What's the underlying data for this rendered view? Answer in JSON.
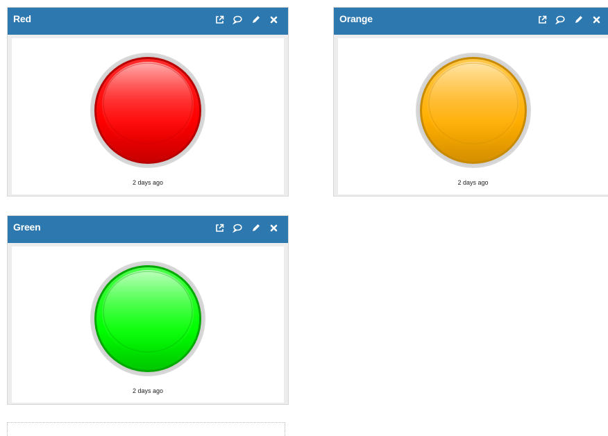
{
  "widgets": [
    {
      "id": "red",
      "title": "Red",
      "status": "red",
      "color": "#ff0000",
      "timestamp": "2 days ago",
      "tools": [
        "external-link-icon",
        "comment-icon",
        "pencil-icon",
        "close-icon"
      ]
    },
    {
      "id": "orange",
      "title": "Orange",
      "status": "orange",
      "color": "#ffae00",
      "timestamp": "2 days ago",
      "tools": [
        "external-link-icon",
        "comment-icon",
        "pencil-icon",
        "close-icon"
      ]
    },
    {
      "id": "green",
      "title": "Green",
      "status": "green",
      "color": "#00ff00",
      "timestamp": "2 days ago",
      "tools": [
        "external-link-icon",
        "comment-icon",
        "pencil-icon",
        "close-icon"
      ]
    }
  ],
  "theme": {
    "header_color": "#2e78b0",
    "header_text_color": "#ffffff"
  }
}
